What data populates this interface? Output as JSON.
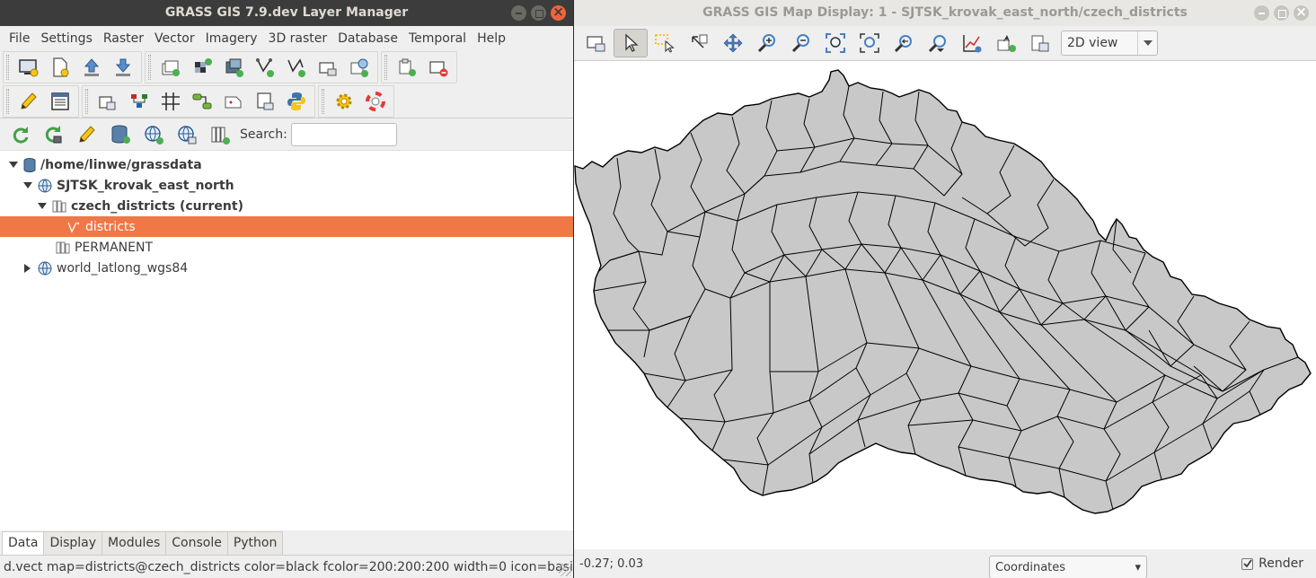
{
  "layer_manager": {
    "title": "GRASS GIS 7.9.dev Layer Manager",
    "menu": [
      "File",
      "Settings",
      "Raster",
      "Vector",
      "Imagery",
      "3D raster",
      "Database",
      "Temporal",
      "Help"
    ],
    "data_toolbar": {
      "search_label": "Search:",
      "search_value": ""
    },
    "tree": {
      "grassdb": "/home/linwe/grassdata",
      "location": "SJTSK_krovak_east_north",
      "mapset_current": "czech_districts  (current)",
      "layer_selected": "districts",
      "mapset_other": "PERMANENT",
      "location_other": "world_latlong_wgs84"
    },
    "tabs": [
      "Data",
      "Display",
      "Modules",
      "Console",
      "Python"
    ],
    "active_tab": "Data",
    "status_text": "d.vect map=districts@czech_districts color=black fcolor=200:200:200 width=0 icon=basic..."
  },
  "map_display": {
    "title": "GRASS GIS Map Display: 1 - SJTSK_krovak_east_north/czech_districts",
    "view_mode": "2D view",
    "coordinates": "-0.27; 0.03",
    "status_mode": "Coordinates",
    "render_label": "Render",
    "render_checked": true,
    "map_fill": "#c8c8c8",
    "map_stroke": "#000000"
  },
  "colors": {
    "selection": "#f07746",
    "titlebar_active": "#3c3c3c",
    "titlebar_inactive": "#e8e7e3",
    "window_bg": "#efefef"
  }
}
